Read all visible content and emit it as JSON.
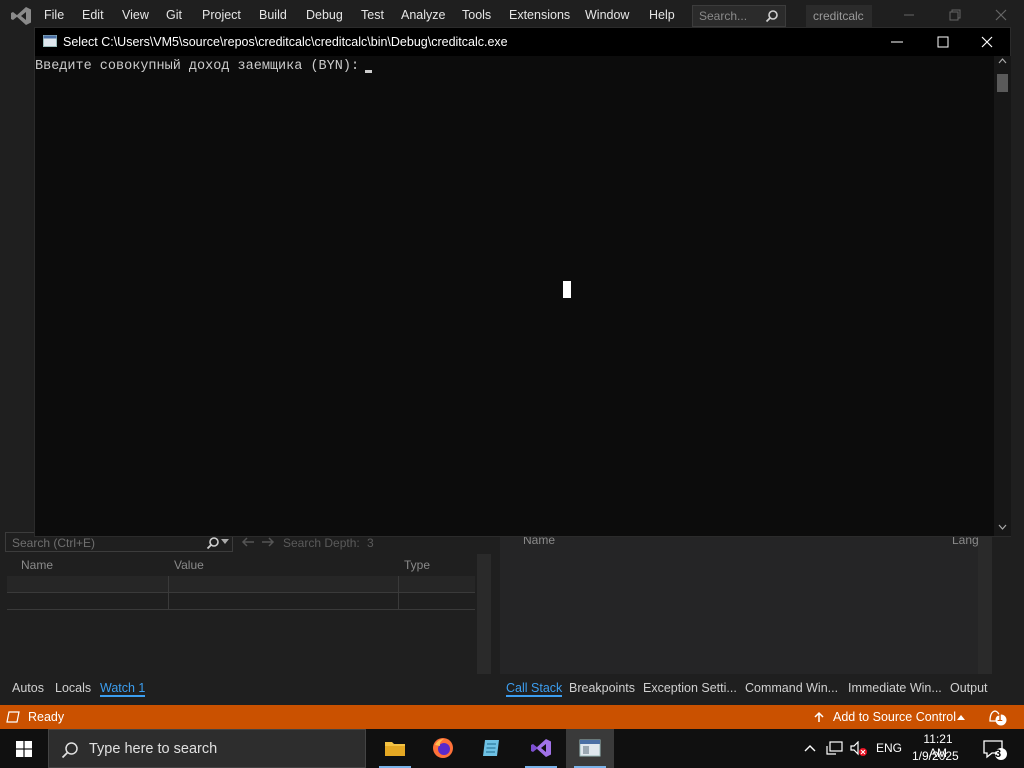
{
  "vs": {
    "menu": [
      "File",
      "Edit",
      "View",
      "Git",
      "Project",
      "Build",
      "Debug",
      "Test",
      "Analyze",
      "Tools",
      "Extensions",
      "Window",
      "Help"
    ],
    "search_placeholder": "Search...",
    "solution_name": "creditcalc",
    "accent_color": "#ca5100"
  },
  "console": {
    "title": "Select C:\\Users\\VM5\\source\\repos\\creditcalc\\creditcalc\\bin\\Debug\\creditcalc.exe",
    "prompt": "Введите совокупный доход заемщика (BYN): ",
    "input_value": ""
  },
  "watch": {
    "search_placeholder": "Search (Ctrl+E)",
    "depth_label": "Search Depth:",
    "depth_value": "3",
    "columns": [
      "Name",
      "Value",
      "Type"
    ],
    "tabs": [
      "Autos",
      "Locals",
      "Watch 1"
    ],
    "active_tab": "Watch 1"
  },
  "callstack": {
    "columns": [
      "Name",
      "Lang"
    ],
    "tabs": [
      "Call Stack",
      "Breakpoints",
      "Exception Setti...",
      "Command Win...",
      "Immediate Win...",
      "Output"
    ],
    "active_tab": "Call Stack"
  },
  "status": {
    "text": "Ready",
    "source_control": "Add to Source Control",
    "notification_count": "1"
  },
  "taskbar": {
    "search_placeholder": "Type here to search",
    "language": "ENG",
    "time": "11:21 AM",
    "date": "1/9/2025",
    "notification_count": "3"
  }
}
